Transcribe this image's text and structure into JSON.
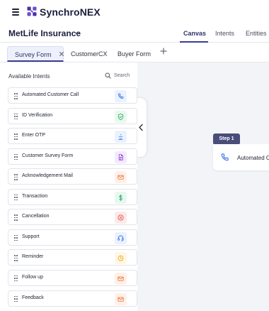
{
  "app": {
    "brand": "SynchroNEX",
    "project_title": "MetLife Insurance"
  },
  "view_tabs": [
    {
      "label": "Canvas",
      "active": true
    },
    {
      "label": "Intents",
      "active": false
    },
    {
      "label": "Entities",
      "active": false
    }
  ],
  "document_tabs": [
    {
      "label": "Survey Form",
      "active": true
    },
    {
      "label": "CustomerCX",
      "active": false
    },
    {
      "label": "Buyer Form",
      "active": false
    }
  ],
  "sidebar": {
    "title": "Available Intents",
    "search_label": "Search",
    "intents": [
      {
        "label": "Automated Customer Call",
        "icon": "phone-icon",
        "color": "#2f6fe0",
        "bg": "#eaf1ff"
      },
      {
        "label": "ID Verification",
        "icon": "shield-check-icon",
        "color": "#29a35a",
        "bg": "#e9f8ef"
      },
      {
        "label": "Enter OTP",
        "icon": "otp-icon",
        "color": "#3473dd",
        "bg": "#eaf1ff"
      },
      {
        "label": "Customer Survey Form",
        "icon": "document-icon",
        "color": "#8a3fd0",
        "bg": "#f3eafe"
      },
      {
        "label": "Acknowledgement Mail",
        "icon": "mail-icon",
        "color": "#ea6a2f",
        "bg": "#fff0e8"
      },
      {
        "label": "Transaction",
        "icon": "dollar-icon",
        "color": "#24a06a",
        "bg": "#e8f8f0"
      },
      {
        "label": "Cancellation",
        "icon": "cancel-icon",
        "color": "#e04848",
        "bg": "#fdeaea"
      },
      {
        "label": "Support",
        "icon": "headset-icon",
        "color": "#3268db",
        "bg": "#eaf1ff"
      },
      {
        "label": "Reminder",
        "icon": "clock-icon",
        "color": "#e7a312",
        "bg": "#fff7e4"
      },
      {
        "label": "Follow up",
        "icon": "mail-icon",
        "color": "#ea6a2f",
        "bg": "#fff0e8"
      },
      {
        "label": "Feedback",
        "icon": "mail-icon",
        "color": "#ea6a2f",
        "bg": "#fff0e8"
      }
    ]
  },
  "canvas": {
    "step_badge": "Step 1",
    "step_label": "Automated Customer Call",
    "step_icon": "phone-icon"
  },
  "colors": {
    "brand": "#4b2ea8",
    "active_tab": "#3b3f8f",
    "step_badge": "#4a4d7a",
    "canvas_bg": "#f2f4f8"
  }
}
